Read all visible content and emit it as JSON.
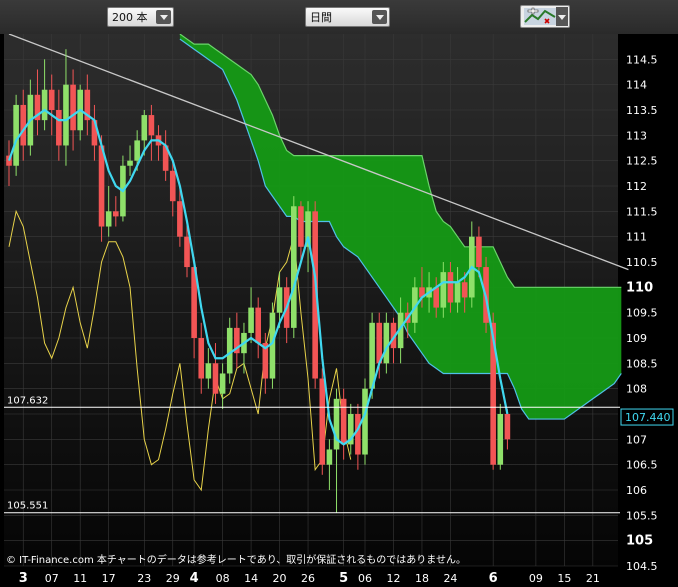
{
  "toolbar": {
    "bars_select": "200 本",
    "period_select": "日間",
    "tool_icon": "chart-tools-icon"
  },
  "copyright": "© IT-Finance.com 本チャートのデータは参考レートであり、取引が保証されるものではありません。",
  "chart_data": {
    "type": "candlestick",
    "ylim": [
      104.5,
      115.0
    ],
    "y_ticks": [
      "114.5",
      "114",
      "113.5",
      "113",
      "112.5",
      "112",
      "111.5",
      "111",
      "110.5",
      "110",
      "109.5",
      "109",
      "108.5",
      "108",
      "107.5",
      "107",
      "106.5",
      "106",
      "105.5",
      "105",
      "104.5"
    ],
    "x_ticks": [
      {
        "label": "3",
        "major": true,
        "i": 2
      },
      {
        "label": "07",
        "major": false,
        "i": 6
      },
      {
        "label": "11",
        "major": false,
        "i": 10
      },
      {
        "label": "17",
        "major": false,
        "i": 14
      },
      {
        "label": "23",
        "major": false,
        "i": 19
      },
      {
        "label": "29",
        "major": false,
        "i": 23
      },
      {
        "label": "4",
        "major": true,
        "i": 26
      },
      {
        "label": "08",
        "major": false,
        "i": 30
      },
      {
        "label": "14",
        "major": false,
        "i": 34
      },
      {
        "label": "20",
        "major": false,
        "i": 38
      },
      {
        "label": "26",
        "major": false,
        "i": 42
      },
      {
        "label": "5",
        "major": true,
        "i": 47
      },
      {
        "label": "06",
        "major": false,
        "i": 50
      },
      {
        "label": "12",
        "major": false,
        "i": 54
      },
      {
        "label": "18",
        "major": false,
        "i": 58
      },
      {
        "label": "24",
        "major": false,
        "i": 62
      },
      {
        "label": "6",
        "major": true,
        "i": 68
      },
      {
        "label": "09",
        "major": false,
        "i": 74
      },
      {
        "label": "15",
        "major": false,
        "i": 78
      },
      {
        "label": "21",
        "major": false,
        "i": 82
      }
    ],
    "last_price": 107.44,
    "last_price_label": "107.440",
    "hlines": [
      {
        "value": 107.632,
        "label": "107.632"
      },
      {
        "value": 105.551,
        "label": "105.551"
      }
    ],
    "trendline": [
      [
        0,
        115.0
      ],
      [
        87,
        110.35
      ]
    ],
    "candles": [
      [
        112.6,
        112.4,
        112.9,
        112.0
      ],
      [
        112.4,
        113.6,
        113.8,
        112.2
      ],
      [
        113.6,
        112.8,
        113.9,
        112.5
      ],
      [
        112.8,
        113.8,
        114.1,
        112.6
      ],
      [
        113.8,
        113.3,
        114.3,
        113.0
      ],
      [
        113.3,
        113.9,
        114.5,
        113.1
      ],
      [
        113.9,
        113.5,
        114.2,
        113.0
      ],
      [
        113.5,
        112.8,
        113.9,
        112.5
      ],
      [
        112.8,
        114.0,
        114.7,
        112.4
      ],
      [
        114.0,
        113.1,
        114.3,
        112.7
      ],
      [
        113.1,
        113.9,
        114.0,
        112.9
      ],
      [
        113.9,
        113.3,
        114.2,
        113.0
      ],
      [
        113.3,
        112.8,
        113.6,
        112.5
      ],
      [
        112.8,
        111.2,
        113.0,
        110.9
      ],
      [
        111.2,
        111.5,
        112.0,
        111.0
      ],
      [
        111.5,
        111.4,
        111.8,
        111.2
      ],
      [
        111.4,
        112.4,
        112.6,
        111.3
      ],
      [
        112.4,
        112.5,
        112.8,
        112.2
      ],
      [
        112.5,
        112.9,
        113.1,
        112.3
      ],
      [
        112.9,
        113.4,
        113.5,
        112.6
      ],
      [
        113.4,
        113.0,
        113.6,
        112.5
      ],
      [
        113.0,
        112.8,
        113.2,
        112.5
      ],
      [
        112.8,
        112.3,
        113.1,
        112.1
      ],
      [
        112.3,
        111.7,
        112.5,
        111.4
      ],
      [
        111.7,
        111.0,
        112.0,
        110.8
      ],
      [
        111.0,
        110.4,
        111.3,
        110.2
      ],
      [
        110.4,
        109.0,
        110.6,
        108.6
      ],
      [
        109.0,
        108.2,
        109.3,
        107.9
      ],
      [
        108.2,
        108.5,
        108.8,
        108.0
      ],
      [
        108.5,
        107.9,
        108.9,
        107.7
      ],
      [
        107.9,
        108.3,
        108.5,
        107.6
      ],
      [
        108.3,
        109.2,
        109.4,
        108.1
      ],
      [
        109.2,
        108.7,
        109.5,
        108.4
      ],
      [
        108.7,
        109.1,
        109.3,
        108.3
      ],
      [
        109.1,
        109.6,
        110.0,
        108.9
      ],
      [
        109.6,
        108.9,
        109.8,
        108.6
      ],
      [
        108.9,
        108.2,
        109.1,
        107.9
      ],
      [
        108.2,
        109.5,
        109.7,
        108.0
      ],
      [
        109.5,
        110.0,
        110.3,
        109.2
      ],
      [
        110.0,
        109.2,
        110.2,
        108.9
      ],
      [
        109.2,
        111.6,
        111.8,
        109.0
      ],
      [
        111.6,
        110.8,
        111.7,
        110.5
      ],
      [
        110.8,
        111.5,
        111.7,
        110.3
      ],
      [
        111.5,
        108.2,
        111.7,
        108.0
      ],
      [
        108.2,
        106.5,
        108.4,
        106.3
      ],
      [
        106.5,
        106.8,
        107.0,
        106.0
      ],
      [
        106.8,
        107.8,
        108.0,
        105.55
      ],
      [
        107.8,
        106.9,
        108.0,
        106.6
      ],
      [
        106.9,
        107.5,
        107.7,
        106.7
      ],
      [
        107.5,
        106.7,
        107.7,
        106.4
      ],
      [
        106.7,
        108.0,
        108.2,
        106.5
      ],
      [
        108.0,
        109.3,
        109.5,
        107.8
      ],
      [
        109.3,
        108.5,
        109.5,
        108.2
      ],
      [
        108.5,
        109.3,
        109.5,
        108.3
      ],
      [
        109.3,
        108.8,
        109.4,
        108.5
      ],
      [
        108.8,
        109.5,
        109.8,
        108.5
      ],
      [
        109.5,
        109.3,
        109.7,
        109.0
      ],
      [
        109.3,
        110.0,
        110.2,
        109.1
      ],
      [
        110.0,
        109.8,
        110.4,
        109.6
      ],
      [
        109.8,
        110.0,
        110.3,
        109.5
      ],
      [
        110.0,
        109.6,
        110.2,
        109.4
      ],
      [
        109.6,
        110.3,
        110.5,
        109.4
      ],
      [
        110.3,
        109.7,
        110.5,
        109.5
      ],
      [
        109.7,
        110.1,
        110.4,
        109.5
      ],
      [
        110.1,
        109.8,
        110.3,
        109.5
      ],
      [
        109.8,
        111.0,
        111.3,
        109.6
      ],
      [
        111.0,
        110.4,
        111.2,
        110.2
      ],
      [
        110.4,
        109.3,
        110.6,
        109.1
      ],
      [
        109.3,
        106.5,
        109.5,
        106.4
      ],
      [
        106.5,
        107.5,
        107.7,
        106.4
      ],
      [
        107.5,
        107.0,
        107.6,
        106.8
      ]
    ],
    "sma": [
      112.5,
      112.9,
      113.1,
      113.3,
      113.4,
      113.5,
      113.4,
      113.3,
      113.3,
      113.4,
      113.5,
      113.4,
      113.3,
      112.8,
      112.3,
      112.0,
      111.9,
      112.1,
      112.4,
      112.7,
      112.9,
      112.9,
      112.8,
      112.5,
      112.0,
      111.3,
      110.5,
      109.6,
      108.9,
      108.6,
      108.6,
      108.7,
      108.8,
      108.9,
      109.0,
      108.9,
      108.8,
      108.9,
      109.3,
      109.6,
      110.0,
      110.5,
      111.0,
      110.2,
      108.6,
      107.4,
      107.0,
      106.9,
      107.0,
      107.2,
      107.5,
      108.0,
      108.5,
      108.8,
      109.0,
      109.2,
      109.4,
      109.6,
      109.8,
      109.9,
      110.0,
      110.1,
      110.1,
      110.1,
      110.2,
      110.4,
      110.3,
      109.8,
      109.0,
      108.2,
      107.5
    ],
    "lagging": [
      110.8,
      111.5,
      111.2,
      110.5,
      109.8,
      108.9,
      108.6,
      109.0,
      109.6,
      110.0,
      109.3,
      108.8,
      109.6,
      110.5,
      110.9,
      110.9,
      110.6,
      110.0,
      108.4,
      107.0,
      106.5,
      106.6,
      107.2,
      107.9,
      108.5,
      107.3,
      106.2,
      106.0,
      107.2,
      108.2,
      107.8,
      107.9,
      108.4,
      108.5,
      108.0,
      107.5,
      108.8,
      109.4,
      110.3,
      110.5,
      111.0,
      109.5,
      108.2,
      106.4,
      106.6,
      107.8,
      108.4,
      107.2,
      106.6
    ],
    "kumo": {
      "start": 24,
      "upper": [
        115.0,
        114.9,
        114.8,
        114.8,
        114.8,
        114.7,
        114.6,
        114.5,
        114.4,
        114.3,
        114.2,
        114.0,
        113.7,
        113.4,
        113.0,
        112.7,
        112.6,
        112.6,
        112.6,
        112.6,
        112.6,
        112.6,
        112.6,
        112.6,
        112.6,
        112.6,
        112.6,
        112.6,
        112.6,
        112.6,
        112.6,
        112.6,
        112.6,
        112.6,
        112.6,
        112.0,
        111.5,
        111.3,
        111.2,
        111.0,
        110.8,
        110.8,
        110.8,
        110.8,
        110.8,
        110.5,
        110.2,
        110.0,
        110.0,
        110.0,
        110.0,
        110.0,
        110.0,
        110.0,
        110.0,
        110.0,
        110.0,
        110.0,
        110.0,
        110.0,
        110.0,
        110.0,
        110.0
      ],
      "lower": [
        114.9,
        114.8,
        114.7,
        114.6,
        114.5,
        114.4,
        114.3,
        114.0,
        113.7,
        113.3,
        112.9,
        112.5,
        112.0,
        111.8,
        111.6,
        111.4,
        111.4,
        111.3,
        111.3,
        111.3,
        111.3,
        111.3,
        111.0,
        110.8,
        110.7,
        110.6,
        110.4,
        110.2,
        110.0,
        109.8,
        109.6,
        109.4,
        109.1,
        108.9,
        108.7,
        108.5,
        108.4,
        108.3,
        108.3,
        108.3,
        108.3,
        108.3,
        108.3,
        108.3,
        108.3,
        108.3,
        108.3,
        108.0,
        107.6,
        107.4,
        107.4,
        107.4,
        107.4,
        107.4,
        107.4,
        107.5,
        107.6,
        107.7,
        107.8,
        107.9,
        108.0,
        108.1,
        108.3
      ]
    }
  }
}
